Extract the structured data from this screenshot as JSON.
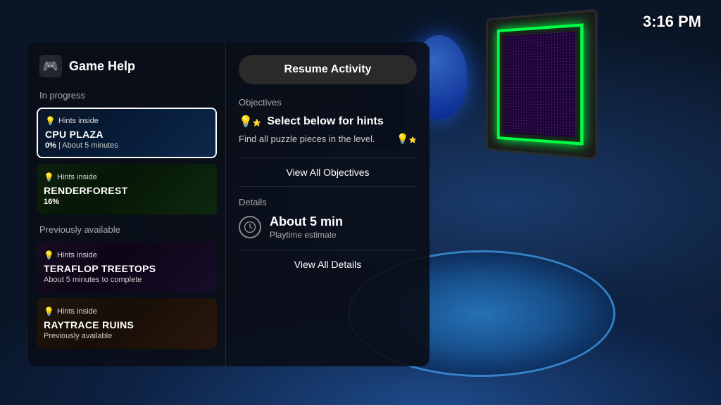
{
  "time": "3:16 PM",
  "panel": {
    "game_help_title": "Game Help",
    "in_progress_label": "In progress",
    "previously_available_label": "Previously available",
    "activities_in_progress": [
      {
        "hints_label": "Hints inside",
        "title": "CPU PLAZA",
        "subtitle_progress": "0%",
        "subtitle_separator": " | ",
        "subtitle_time": "About 5 minutes",
        "active": true,
        "bg_class": "cpu-plaza-bg"
      },
      {
        "hints_label": "Hints inside",
        "title": "RENDERFOREST",
        "subtitle_progress": "16%",
        "subtitle_separator": "",
        "subtitle_time": "",
        "active": false,
        "bg_class": "renderforest-bg"
      }
    ],
    "activities_prev": [
      {
        "hints_label": "Hints inside",
        "title": "TERAFLOP TREETOPS",
        "subtitle": "About 5 minutes to complete",
        "bg_class": "teraflop-bg"
      },
      {
        "hints_label": "Hints inside",
        "title": "RAYTRACE RUINS",
        "subtitle": "Previously available",
        "bg_class": "raytrace-bg"
      }
    ]
  },
  "content": {
    "resume_button": "Resume Activity",
    "objectives_label": "Objectives",
    "select_hints_text": "Select below for hints",
    "objective_description": "Find all puzzle pieces in the level.",
    "view_all_objectives_button": "View All Objectives",
    "details_label": "Details",
    "playtime_amount": "About 5 min",
    "playtime_label": "Playtime estimate",
    "view_all_details_button": "View All Details"
  },
  "icons": {
    "game_help": "🎮",
    "hints": "💡",
    "hints_double": "💡⭐",
    "hint_star": "💡⭐",
    "clock": "🕐"
  }
}
